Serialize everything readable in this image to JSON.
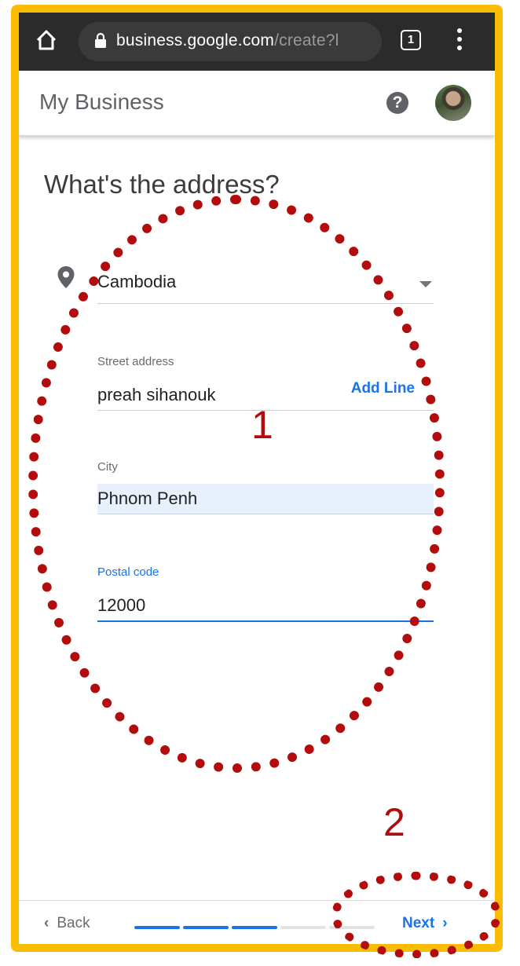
{
  "browser": {
    "url_host": "business.google.com",
    "url_path": "/create?l",
    "tab_count": "1"
  },
  "header": {
    "title": "My Business",
    "help_glyph": "?"
  },
  "page": {
    "heading": "What's the address?"
  },
  "form": {
    "country": "Cambodia",
    "street_label": "Street address",
    "street_value": "preah sihanouk",
    "add_line_label": "Add Line",
    "city_label": "City",
    "city_value": "Phnom Penh",
    "postal_label": "Postal code",
    "postal_value": "12000"
  },
  "annotations": {
    "label_one": "1",
    "label_two": "2",
    "color": "#b30c0c"
  },
  "footer": {
    "back_label": "Back",
    "next_label": "Next",
    "progress_steps": 5,
    "progress_completed": 3
  },
  "colors": {
    "frame": "#fbbc04",
    "accent": "#1a73e8",
    "chrome": "#2b2b2b"
  }
}
